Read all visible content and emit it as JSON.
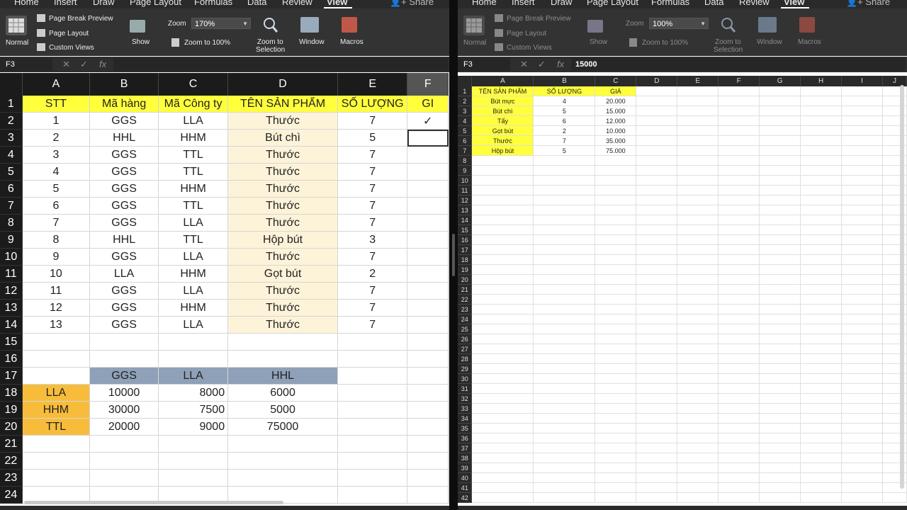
{
  "ribbon": {
    "tabs": [
      "Home",
      "Insert",
      "Draw",
      "Page Layout",
      "Formulas",
      "Data",
      "Review",
      "View"
    ],
    "active_tab": "View",
    "share_label": "Share",
    "normal_label": "Normal",
    "page_break_preview_label": "Page Break Preview",
    "page_layout_label": "Page Layout",
    "custom_views_label": "Custom Views",
    "show_label": "Show",
    "zoom_label": "Zoom",
    "zoom_100_label": "Zoom to 100%",
    "zoom_selection_line1": "Zoom to",
    "zoom_selection_line2": "Selection",
    "window_label": "Window",
    "macros_label": "Macros"
  },
  "left_window": {
    "zoom": "170%",
    "name_box": "F3",
    "formula": "",
    "columns": [
      "A",
      "B",
      "C",
      "D",
      "E",
      "F"
    ],
    "rows": [
      [
        "STT",
        "Mã hàng",
        "Mã Công ty",
        "TÊN SẢN PHẨM",
        "SỐ LƯỢNG",
        "GI"
      ],
      [
        "1",
        "GGS",
        "LLA",
        "Thước",
        "7",
        "✓"
      ],
      [
        "2",
        "HHL",
        "HHM",
        "Bút chì",
        "5",
        ""
      ],
      [
        "3",
        "GGS",
        "TTL",
        "Thước",
        "7",
        ""
      ],
      [
        "4",
        "GGS",
        "TTL",
        "Thước",
        "7",
        ""
      ],
      [
        "5",
        "GGS",
        "HHM",
        "Thước",
        "7",
        ""
      ],
      [
        "6",
        "GGS",
        "TTL",
        "Thước",
        "7",
        ""
      ],
      [
        "7",
        "GGS",
        "LLA",
        "Thước",
        "7",
        ""
      ],
      [
        "8",
        "HHL",
        "TTL",
        "Hộp bút",
        "3",
        ""
      ],
      [
        "9",
        "GGS",
        "LLA",
        "Thước",
        "7",
        ""
      ],
      [
        "10",
        "LLA",
        "HHM",
        "Gọt bút",
        "2",
        ""
      ],
      [
        "11",
        "GGS",
        "LLA",
        "Thước",
        "7",
        ""
      ],
      [
        "12",
        "GGS",
        "HHM",
        "Thước",
        "7",
        ""
      ],
      [
        "13",
        "GGS",
        "LLA",
        "Thước",
        "7",
        ""
      ],
      [
        "",
        "",
        "",
        "",
        "",
        ""
      ],
      [
        "",
        "",
        "",
        "",
        "",
        ""
      ],
      [
        "",
        "GGS",
        "LLA",
        "HHL",
        "",
        ""
      ],
      [
        "LLA",
        "10000",
        "8000",
        "6000",
        "",
        ""
      ],
      [
        "HHM",
        "30000",
        "7500",
        "5000",
        "",
        ""
      ],
      [
        "TTL",
        "20000",
        "9000",
        "75000",
        "",
        ""
      ],
      [
        "",
        "",
        "",
        "",
        "",
        ""
      ],
      [
        "",
        "",
        "",
        "",
        "",
        ""
      ],
      [
        "",
        "",
        "",
        "",
        "",
        ""
      ],
      [
        "",
        "",
        "",
        "",
        "",
        ""
      ]
    ]
  },
  "right_window": {
    "zoom": "100%",
    "name_box": "F3",
    "formula": "15000",
    "columns": [
      "A",
      "B",
      "C",
      "D",
      "E",
      "F",
      "G",
      "H",
      "I",
      "J"
    ],
    "rows": [
      [
        "TÊN SẢN PHẨM",
        "SỐ LƯỢNG",
        "GIÁ"
      ],
      [
        "Bút mực",
        "4",
        "20.000"
      ],
      [
        "Bút chì",
        "5",
        "15.000"
      ],
      [
        "Tẩy",
        "6",
        "12.000"
      ],
      [
        "Gọt bút",
        "2",
        "10.000"
      ],
      [
        "Thước",
        "7",
        "35.000"
      ],
      [
        "Hộp bút",
        "5",
        "75.000"
      ]
    ],
    "row_count": 42
  },
  "colors": {
    "header_yellow": "#ffff3c",
    "product_beige": "#fdf3d8",
    "pivot_blue": "#8ea1b9",
    "pivot_orange": "#f7bd3a",
    "ribbon_bg": "#333333"
  }
}
